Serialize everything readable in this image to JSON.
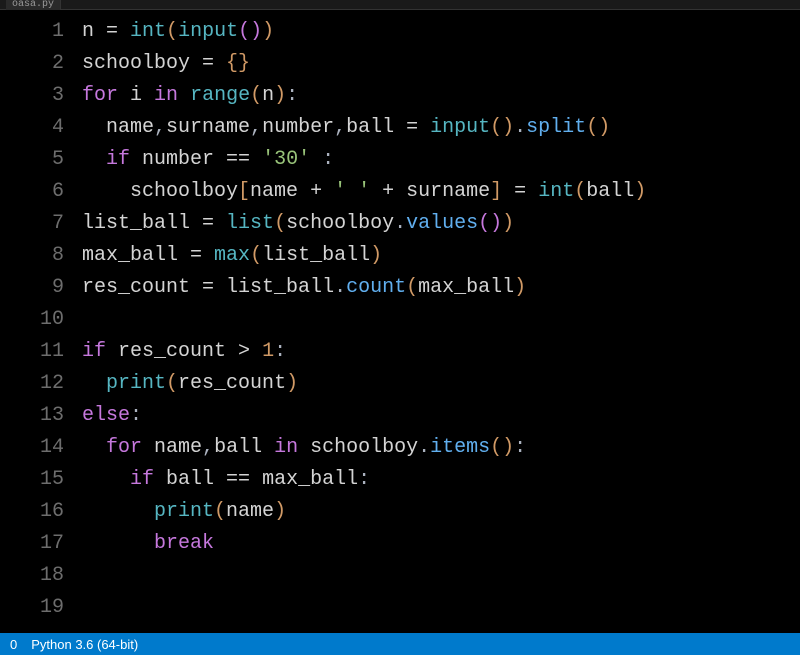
{
  "tab": {
    "filename": "oasa.py"
  },
  "statusbar": {
    "diagnostics": "0",
    "interpreter": "Python 3.6 (64-bit)"
  },
  "lines": [
    [
      {
        "cls": "tk-var",
        "t": "n "
      },
      {
        "cls": "tk-op",
        "t": "= "
      },
      {
        "cls": "tk-builtin",
        "t": "int"
      },
      {
        "cls": "tk-bracket-y",
        "t": "("
      },
      {
        "cls": "tk-builtin",
        "t": "input"
      },
      {
        "cls": "tk-bracket-p",
        "t": "()"
      },
      {
        "cls": "tk-bracket-y",
        "t": ")"
      }
    ],
    [
      {
        "cls": "tk-var",
        "t": "schoolboy "
      },
      {
        "cls": "tk-op",
        "t": "= "
      },
      {
        "cls": "tk-bracket-y",
        "t": "{}"
      }
    ],
    [
      {
        "cls": "tk-kw",
        "t": "for"
      },
      {
        "cls": "tk-var",
        "t": " i "
      },
      {
        "cls": "tk-kw",
        "t": "in"
      },
      {
        "cls": "tk-var",
        "t": " "
      },
      {
        "cls": "tk-builtin",
        "t": "range"
      },
      {
        "cls": "tk-bracket-y",
        "t": "("
      },
      {
        "cls": "tk-var",
        "t": "n"
      },
      {
        "cls": "tk-bracket-y",
        "t": ")"
      },
      {
        "cls": "tk-punc",
        "t": ":"
      }
    ],
    [
      {
        "cls": "tk-var",
        "t": "  name"
      },
      {
        "cls": "tk-punc",
        "t": ","
      },
      {
        "cls": "tk-var",
        "t": "surname"
      },
      {
        "cls": "tk-punc",
        "t": ","
      },
      {
        "cls": "tk-var",
        "t": "number"
      },
      {
        "cls": "tk-punc",
        "t": ","
      },
      {
        "cls": "tk-var",
        "t": "ball "
      },
      {
        "cls": "tk-op",
        "t": "= "
      },
      {
        "cls": "tk-builtin",
        "t": "input"
      },
      {
        "cls": "tk-bracket-y",
        "t": "()"
      },
      {
        "cls": "tk-punc",
        "t": "."
      },
      {
        "cls": "tk-fn",
        "t": "split"
      },
      {
        "cls": "tk-bracket-y",
        "t": "()"
      }
    ],
    [
      {
        "cls": "tk-var",
        "t": "  "
      },
      {
        "cls": "tk-kw",
        "t": "if"
      },
      {
        "cls": "tk-var",
        "t": " number "
      },
      {
        "cls": "tk-op",
        "t": "== "
      },
      {
        "cls": "tk-str",
        "t": "'30'"
      },
      {
        "cls": "tk-var",
        "t": " "
      },
      {
        "cls": "tk-punc",
        "t": ":"
      }
    ],
    [
      {
        "cls": "tk-var",
        "t": "    schoolboy"
      },
      {
        "cls": "tk-bracket-y",
        "t": "["
      },
      {
        "cls": "tk-var",
        "t": "name "
      },
      {
        "cls": "tk-op",
        "t": "+ "
      },
      {
        "cls": "tk-str",
        "t": "' '"
      },
      {
        "cls": "tk-var",
        "t": " "
      },
      {
        "cls": "tk-op",
        "t": "+ "
      },
      {
        "cls": "tk-var",
        "t": "surname"
      },
      {
        "cls": "tk-bracket-y",
        "t": "]"
      },
      {
        "cls": "tk-var",
        "t": " "
      },
      {
        "cls": "tk-op",
        "t": "= "
      },
      {
        "cls": "tk-builtin",
        "t": "int"
      },
      {
        "cls": "tk-bracket-y",
        "t": "("
      },
      {
        "cls": "tk-var",
        "t": "ball"
      },
      {
        "cls": "tk-bracket-y",
        "t": ")"
      }
    ],
    [
      {
        "cls": "tk-var",
        "t": "list_ball "
      },
      {
        "cls": "tk-op",
        "t": "= "
      },
      {
        "cls": "tk-builtin",
        "t": "list"
      },
      {
        "cls": "tk-bracket-y",
        "t": "("
      },
      {
        "cls": "tk-var",
        "t": "schoolboy"
      },
      {
        "cls": "tk-punc",
        "t": "."
      },
      {
        "cls": "tk-fn",
        "t": "values"
      },
      {
        "cls": "tk-bracket-p",
        "t": "()"
      },
      {
        "cls": "tk-bracket-y",
        "t": ")"
      }
    ],
    [
      {
        "cls": "tk-var",
        "t": "max_ball "
      },
      {
        "cls": "tk-op",
        "t": "= "
      },
      {
        "cls": "tk-builtin",
        "t": "max"
      },
      {
        "cls": "tk-bracket-y",
        "t": "("
      },
      {
        "cls": "tk-var",
        "t": "list_ball"
      },
      {
        "cls": "tk-bracket-y",
        "t": ")"
      }
    ],
    [
      {
        "cls": "tk-var",
        "t": "res_count "
      },
      {
        "cls": "tk-op",
        "t": "= "
      },
      {
        "cls": "tk-var",
        "t": "list_ball"
      },
      {
        "cls": "tk-punc",
        "t": "."
      },
      {
        "cls": "tk-fn",
        "t": "count"
      },
      {
        "cls": "tk-bracket-y",
        "t": "("
      },
      {
        "cls": "tk-var",
        "t": "max_ball"
      },
      {
        "cls": "tk-bracket-y",
        "t": ")"
      }
    ],
    [],
    [
      {
        "cls": "tk-kw",
        "t": "if"
      },
      {
        "cls": "tk-var",
        "t": " res_count "
      },
      {
        "cls": "tk-op",
        "t": "> "
      },
      {
        "cls": "tk-num",
        "t": "1"
      },
      {
        "cls": "tk-punc",
        "t": ":"
      }
    ],
    [
      {
        "cls": "tk-var",
        "t": "  "
      },
      {
        "cls": "tk-builtin",
        "t": "print"
      },
      {
        "cls": "tk-bracket-y",
        "t": "("
      },
      {
        "cls": "tk-var",
        "t": "res_count"
      },
      {
        "cls": "tk-bracket-y",
        "t": ")"
      }
    ],
    [
      {
        "cls": "tk-kw",
        "t": "else"
      },
      {
        "cls": "tk-punc",
        "t": ":"
      }
    ],
    [
      {
        "cls": "tk-var",
        "t": "  "
      },
      {
        "cls": "tk-kw",
        "t": "for"
      },
      {
        "cls": "tk-var",
        "t": " name"
      },
      {
        "cls": "tk-punc",
        "t": ","
      },
      {
        "cls": "tk-var",
        "t": "ball "
      },
      {
        "cls": "tk-kw",
        "t": "in"
      },
      {
        "cls": "tk-var",
        "t": " schoolboy"
      },
      {
        "cls": "tk-punc",
        "t": "."
      },
      {
        "cls": "tk-fn",
        "t": "items"
      },
      {
        "cls": "tk-bracket-y",
        "t": "()"
      },
      {
        "cls": "tk-punc",
        "t": ":"
      }
    ],
    [
      {
        "cls": "tk-var",
        "t": "    "
      },
      {
        "cls": "tk-kw",
        "t": "if"
      },
      {
        "cls": "tk-var",
        "t": " ball "
      },
      {
        "cls": "tk-op",
        "t": "== "
      },
      {
        "cls": "tk-var",
        "t": "max_ball"
      },
      {
        "cls": "tk-punc",
        "t": ":"
      }
    ],
    [
      {
        "cls": "tk-var",
        "t": "      "
      },
      {
        "cls": "tk-builtin",
        "t": "print"
      },
      {
        "cls": "tk-bracket-y",
        "t": "("
      },
      {
        "cls": "tk-var",
        "t": "name"
      },
      {
        "cls": "tk-bracket-y",
        "t": ")"
      }
    ],
    [
      {
        "cls": "tk-var",
        "t": "      "
      },
      {
        "cls": "tk-kw",
        "t": "break"
      }
    ],
    [],
    []
  ]
}
